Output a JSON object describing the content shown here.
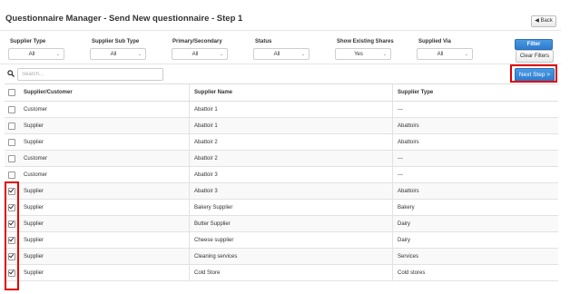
{
  "header": {
    "title": "Questionnaire Manager - Send New questionnaire - Step 1",
    "back_label": "◀ Back"
  },
  "filters": [
    {
      "label": "Supplier Type",
      "value": "All"
    },
    {
      "label": "Supplier Sub Type",
      "value": "All"
    },
    {
      "label": "Primary/Secondary",
      "value": "All"
    },
    {
      "label": "Status",
      "value": "All"
    },
    {
      "label": "Show Existing Shares",
      "value": "Yes"
    },
    {
      "label": "Supplied Via",
      "value": "All"
    }
  ],
  "filter_button": "Filter",
  "clear_filters_button": "Clear Filters",
  "search": {
    "placeholder": "Search..."
  },
  "next_step_button": "Next Step >",
  "table": {
    "columns": [
      "Supplier/Customer",
      "Supplier Name",
      "Supplier Type"
    ],
    "rows": [
      {
        "checked": false,
        "kind": "Customer",
        "name": "Abattoir 1",
        "type": "---"
      },
      {
        "checked": false,
        "kind": "Supplier",
        "name": "Abattoir 1",
        "type": "Abattoirs"
      },
      {
        "checked": false,
        "kind": "Supplier",
        "name": "Abattoir 2",
        "type": "Abattoirs"
      },
      {
        "checked": false,
        "kind": "Customer",
        "name": "Abattoir 2",
        "type": "---"
      },
      {
        "checked": false,
        "kind": "Customer",
        "name": "Abattoir 3",
        "type": "---"
      },
      {
        "checked": true,
        "kind": "Supplier",
        "name": "Abattoir 3",
        "type": "Abattoirs"
      },
      {
        "checked": true,
        "kind": "Supplier",
        "name": "Bakery Supplier",
        "type": "Bakery"
      },
      {
        "checked": true,
        "kind": "Supplier",
        "name": "Butter Supplier",
        "type": "Dairy"
      },
      {
        "checked": true,
        "kind": "Supplier",
        "name": "Cheese supplier",
        "type": "Dairy"
      },
      {
        "checked": true,
        "kind": "Supplier",
        "name": "Cleaning services",
        "type": "Services"
      },
      {
        "checked": true,
        "kind": "Supplier",
        "name": "Cold Store",
        "type": "Cold stores"
      }
    ]
  },
  "colors": {
    "primary_button": "#2e7bcf",
    "highlight": "#e00000"
  },
  "icons": {
    "back": "back-arrow-icon",
    "search": "magnifier-icon",
    "select": "chevron-down-icon"
  }
}
